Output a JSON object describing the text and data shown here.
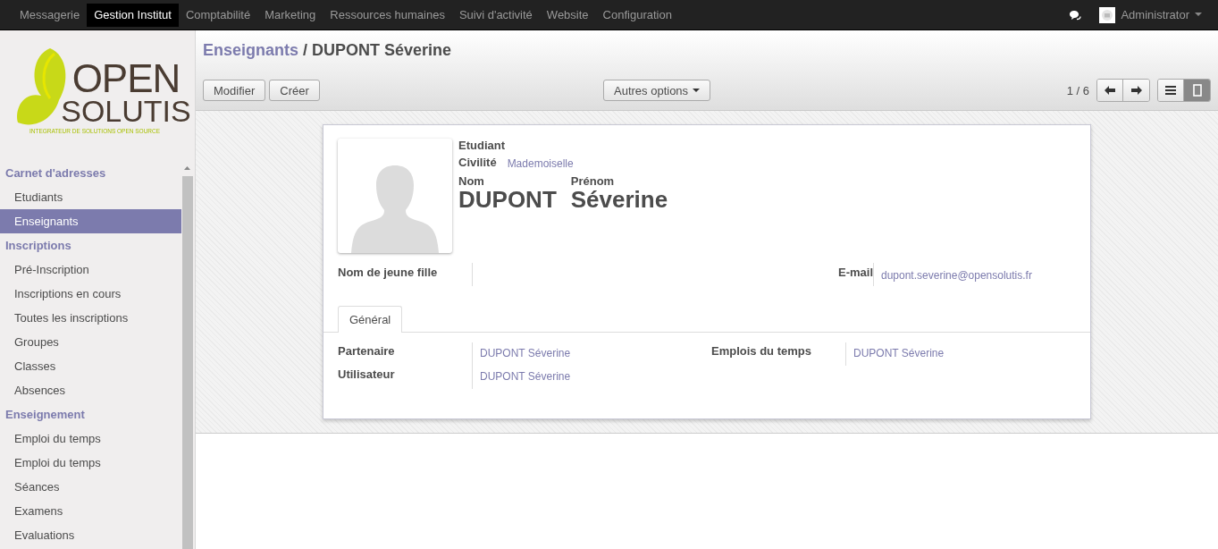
{
  "topbar": {
    "menus": [
      {
        "label": "Messagerie",
        "selected": false
      },
      {
        "label": "Gestion Institut",
        "selected": true
      },
      {
        "label": "Comptabilité",
        "selected": false
      },
      {
        "label": "Marketing",
        "selected": false
      },
      {
        "label": "Ressources humaines",
        "selected": false
      },
      {
        "label": "Suivi d'activité",
        "selected": false
      },
      {
        "label": "Website",
        "selected": false
      },
      {
        "label": "Configuration",
        "selected": false
      }
    ],
    "user": "Administrator"
  },
  "logo": {
    "line1": "OPEN",
    "line2": "SOLUTIS",
    "tagline": "INTEGRATEUR DE SOLUTIONS OPEN SOURCE"
  },
  "sidebar": {
    "sections": [
      {
        "title": "Carnet d'adresses",
        "items": [
          {
            "label": "Etudiants",
            "selected": false
          },
          {
            "label": "Enseignants",
            "selected": true
          }
        ]
      },
      {
        "title": "Inscriptions",
        "items": [
          {
            "label": "Pré-Inscription",
            "selected": false
          },
          {
            "label": "Inscriptions en cours",
            "selected": false
          },
          {
            "label": "Toutes les inscriptions",
            "selected": false
          },
          {
            "label": "Groupes",
            "selected": false
          },
          {
            "label": "Classes",
            "selected": false
          },
          {
            "label": "Absences",
            "selected": false
          }
        ]
      },
      {
        "title": "Enseignement",
        "items": [
          {
            "label": "Emploi du temps",
            "selected": false
          },
          {
            "label": "Emploi du temps",
            "selected": false
          },
          {
            "label": "Séances",
            "selected": false
          },
          {
            "label": "Examens",
            "selected": false
          },
          {
            "label": "Evaluations",
            "selected": false
          }
        ]
      }
    ]
  },
  "breadcrumb": {
    "parent": "Enseignants",
    "separator": "/",
    "current": "DUPONT Séverine"
  },
  "buttons": [
    "Modifier",
    "Créer"
  ],
  "options_button": "Autres options",
  "pager": "1 / 6",
  "views": [
    {
      "kind": "list",
      "selected": false
    },
    {
      "kind": "form",
      "selected": true
    }
  ],
  "form": {
    "type_label": "Etudiant",
    "civility_label": "Civilité",
    "civility_value": "Mademoiselle",
    "nom_label": "Nom",
    "nom_value": "DUPONT",
    "prenom_label": "Prénom",
    "prenom_value": "Séverine",
    "maiden_label": "Nom de jeune fille",
    "email_label": "E-mail",
    "email_value": "dupont.severine@opensolutis.fr",
    "tabs": [
      {
        "label": "Général",
        "selected": true
      }
    ],
    "left_fields": [
      {
        "label": "Partenaire",
        "value": "DUPONT Séverine"
      },
      {
        "label": "Utilisateur",
        "value": "DUPONT Séverine"
      }
    ],
    "right_fields": [
      {
        "label": "Emplois du temps",
        "value": "DUPONT Séverine"
      }
    ]
  }
}
